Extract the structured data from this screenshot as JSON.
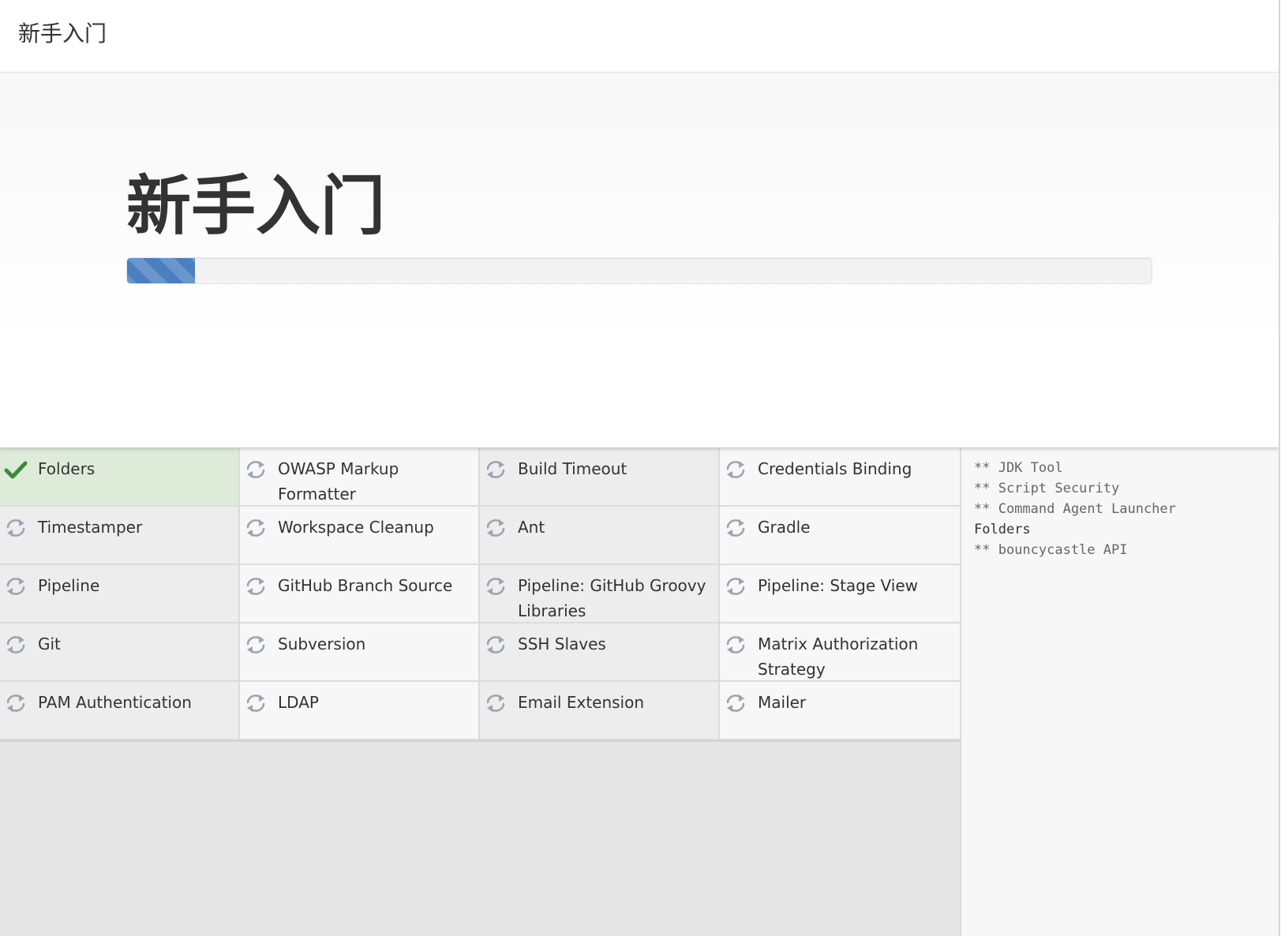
{
  "header": {
    "title": "新手入门"
  },
  "hero": {
    "title": "新手入门",
    "progress_percent": 6.6
  },
  "colors": {
    "progress": "#4a7fc0",
    "installed_bg": "#deebd9",
    "check": "#3b8a3b",
    "pending_icon": "#9aa6b3"
  },
  "plugins": [
    {
      "name": "Folders",
      "status": "installed",
      "icon": "check-icon"
    },
    {
      "name": "OWASP Markup Formatter",
      "status": "pending",
      "icon": "refresh-icon"
    },
    {
      "name": "Build Timeout",
      "status": "pending",
      "icon": "refresh-icon"
    },
    {
      "name": "Credentials Binding",
      "status": "pending",
      "icon": "refresh-icon"
    },
    {
      "name": "Timestamper",
      "status": "pending",
      "icon": "refresh-icon"
    },
    {
      "name": "Workspace Cleanup",
      "status": "pending",
      "icon": "refresh-icon"
    },
    {
      "name": "Ant",
      "status": "pending",
      "icon": "refresh-icon"
    },
    {
      "name": "Gradle",
      "status": "pending",
      "icon": "refresh-icon"
    },
    {
      "name": "Pipeline",
      "status": "pending",
      "icon": "refresh-icon"
    },
    {
      "name": "GitHub Branch Source",
      "status": "pending",
      "icon": "refresh-icon"
    },
    {
      "name": "Pipeline: GitHub Groovy Libraries",
      "status": "pending",
      "icon": "refresh-icon"
    },
    {
      "name": "Pipeline: Stage View",
      "status": "pending",
      "icon": "refresh-icon"
    },
    {
      "name": "Git",
      "status": "pending",
      "icon": "refresh-icon"
    },
    {
      "name": "Subversion",
      "status": "pending",
      "icon": "refresh-icon"
    },
    {
      "name": "SSH Slaves",
      "status": "pending",
      "icon": "refresh-icon"
    },
    {
      "name": "Matrix Authorization Strategy",
      "status": "pending",
      "icon": "refresh-icon"
    },
    {
      "name": "PAM Authentication",
      "status": "pending",
      "icon": "refresh-icon"
    },
    {
      "name": "LDAP",
      "status": "pending",
      "icon": "refresh-icon"
    },
    {
      "name": "Email Extension",
      "status": "pending",
      "icon": "refresh-icon"
    },
    {
      "name": "Mailer",
      "status": "pending",
      "icon": "refresh-icon"
    }
  ],
  "log": [
    {
      "text": "** JDK Tool",
      "kind": "dependency"
    },
    {
      "text": "** Script Security",
      "kind": "dependency"
    },
    {
      "text": "** Command Agent Launcher",
      "kind": "dependency"
    },
    {
      "text": "Folders",
      "kind": "plugin"
    },
    {
      "text": "** bouncycastle API",
      "kind": "dependency"
    }
  ]
}
